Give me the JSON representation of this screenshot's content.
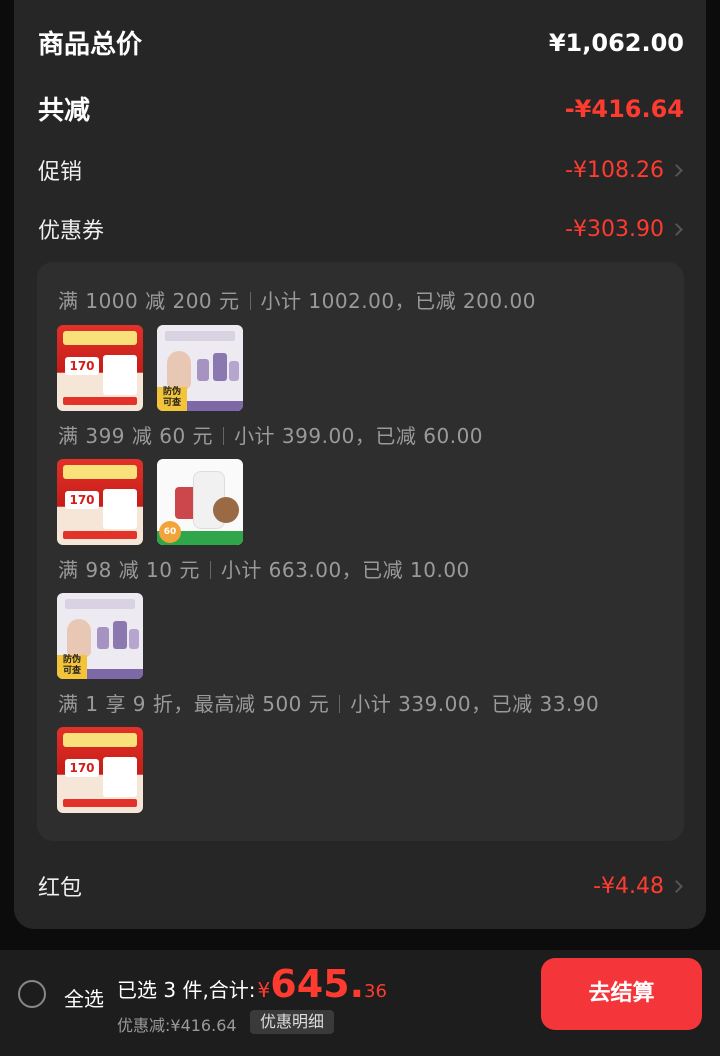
{
  "summary": {
    "total_label": "商品总价",
    "total_value": "¥1,062.00",
    "reduce_label": "共减",
    "reduce_value": "-¥416.64",
    "promo_label": "促销",
    "promo_value": "-¥108.26",
    "coupon_label": "优惠券",
    "coupon_value": "-¥303.90",
    "redpacket_label": "红包",
    "redpacket_value": "-¥4.48"
  },
  "coupon_groups": [
    {
      "rule": "满 1000 减 200 元",
      "detail": "小计 1002.00，已减 200.00",
      "products": [
        "red-box-product",
        "lilac-beauty-product"
      ]
    },
    {
      "rule": "满 399 减 60 元",
      "detail": "小计 399.00，已减 60.00",
      "products": [
        "red-box-product",
        "white-bottle-product"
      ]
    },
    {
      "rule": "满 98 减 10 元",
      "detail": "小计 663.00，已减 10.00",
      "products": [
        "lilac-beauty-product"
      ]
    },
    {
      "rule": "满 1 享 9 折，最高减 500 元",
      "detail": "小计 339.00，已减 33.90",
      "products": [
        "red-box-product"
      ]
    }
  ],
  "thumbs": {
    "red_box_text": "170",
    "lilac_tag": "防伪 可查",
    "white_num": "60"
  },
  "bottom": {
    "select_all": "全选",
    "selected_text": "已选 3 件,合计:",
    "currency": "¥",
    "amount_int": "645.",
    "amount_cents": "36",
    "discount_text": "优惠减:¥416.64",
    "detail_btn": "优惠明细",
    "checkout": "去结算"
  },
  "colors": {
    "accent_red": "#ff3b30",
    "checkout_bg": "#f4363b",
    "panel_bg": "#262626"
  }
}
